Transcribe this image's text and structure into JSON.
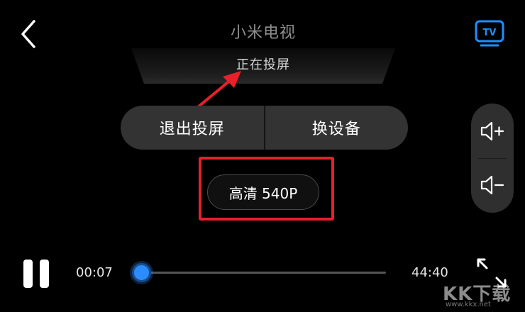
{
  "device": {
    "name": "小米电视",
    "status": "正在投屏"
  },
  "controls": {
    "exit_label": "退出投屏",
    "switch_label": "换设备"
  },
  "quality": {
    "label": "高清 540P"
  },
  "playback": {
    "current_time": "00:07",
    "total_time": "44:40",
    "progress_fraction": 0.003,
    "state": "playing"
  },
  "icons": {
    "back": "chevron-left-icon",
    "tv": "tv-icon",
    "volume_up": "volume-up-icon",
    "volume_down": "volume-down-icon",
    "pause": "pause-icon",
    "fullscreen": "fullscreen-icon"
  },
  "colors": {
    "accent": "#2a8cff",
    "annotation": "#e8202a",
    "background": "#000000"
  },
  "watermark": {
    "text": "KK下载",
    "url": "www.kkx.net"
  }
}
